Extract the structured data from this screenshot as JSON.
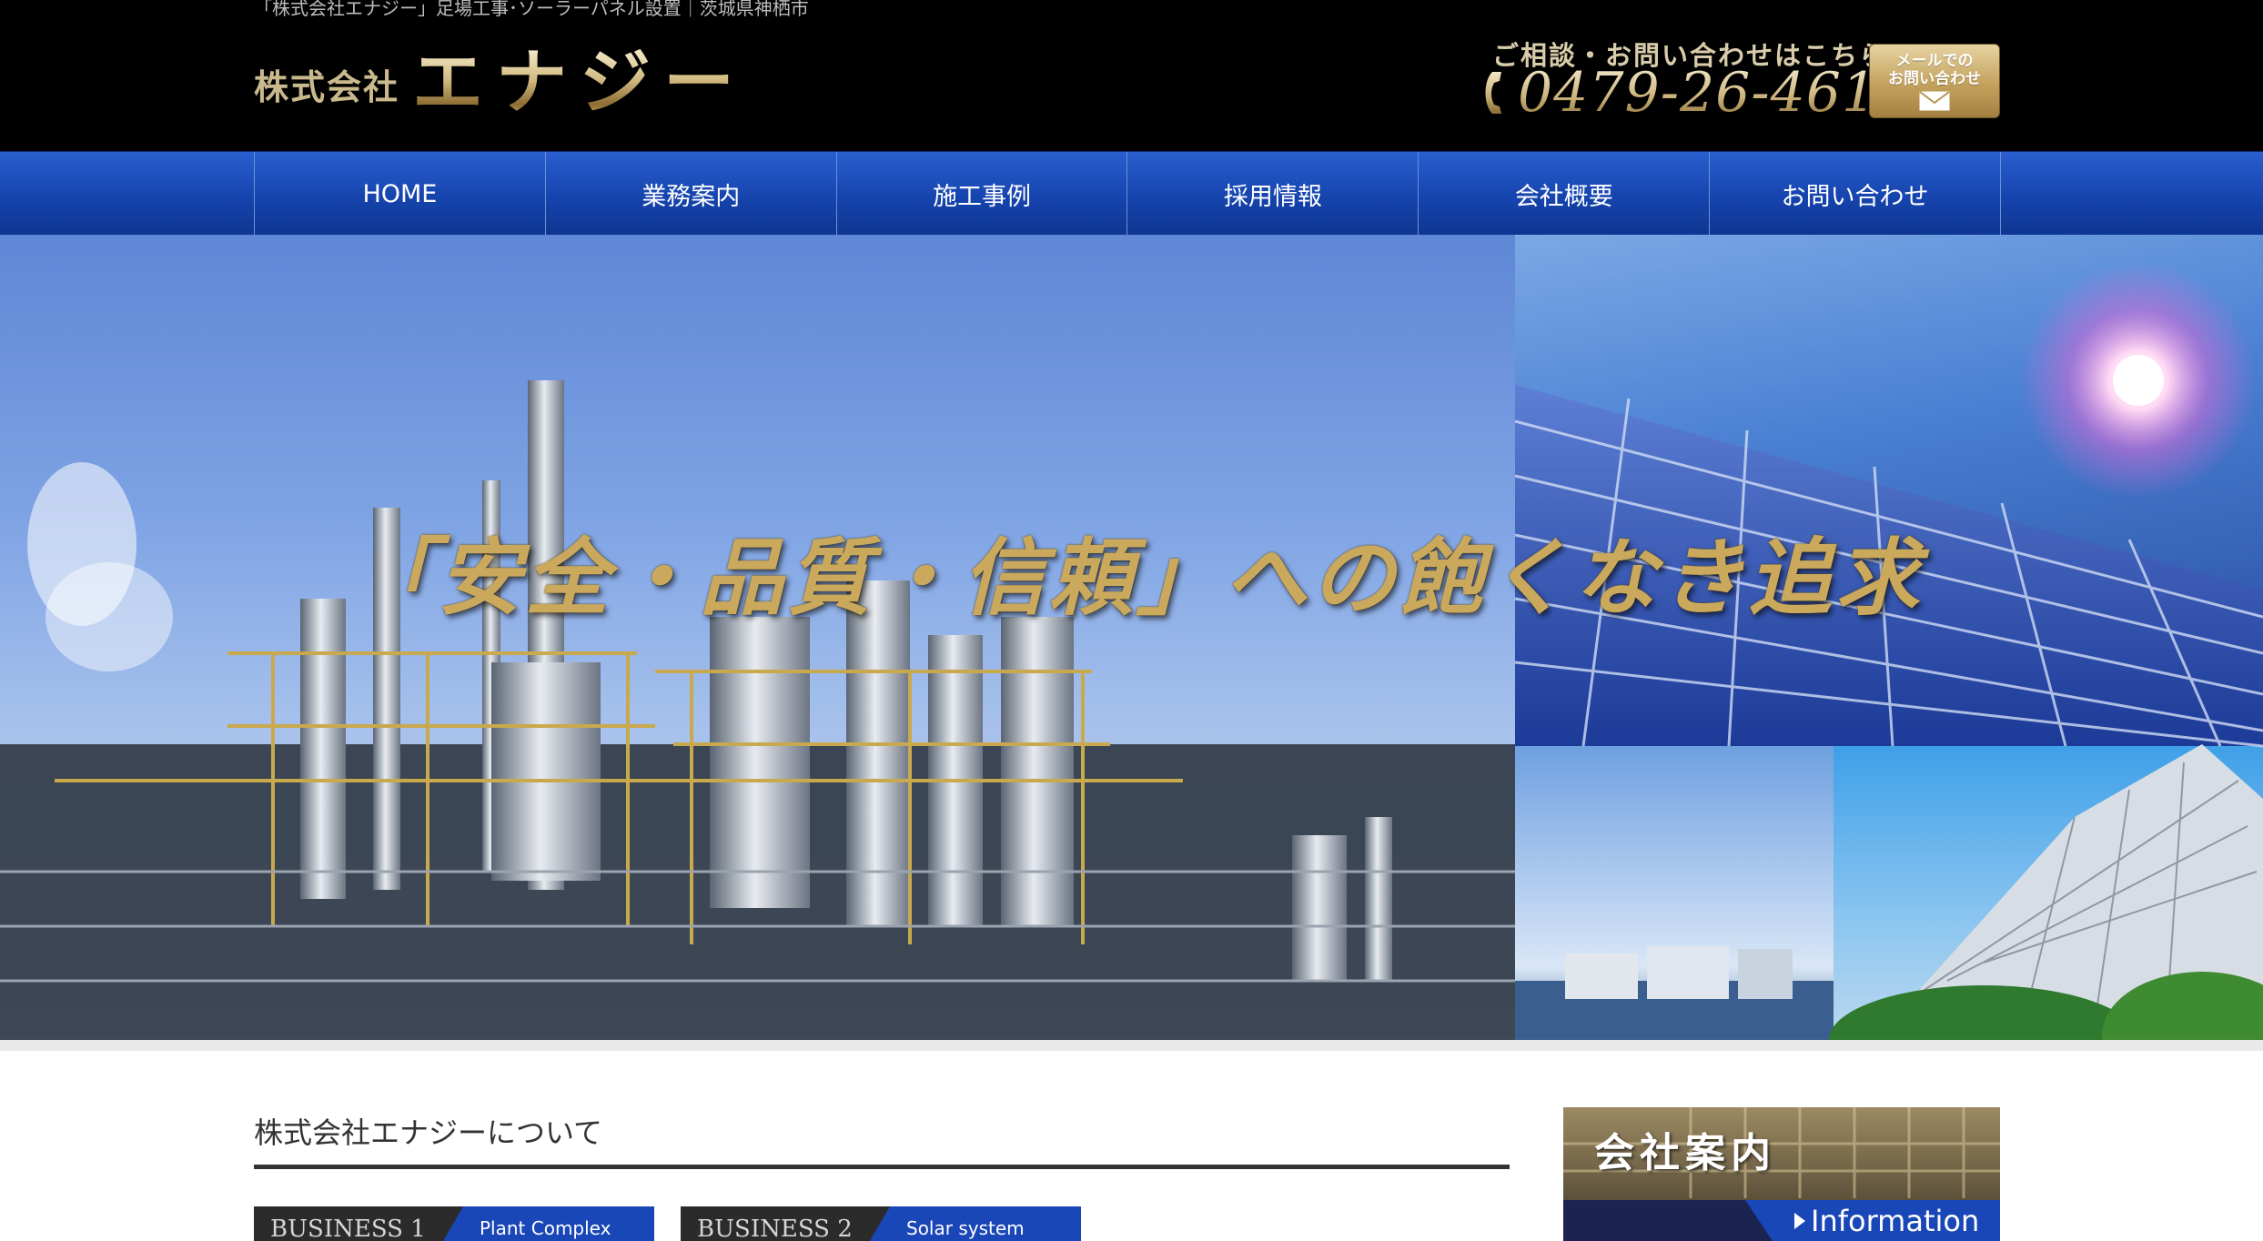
{
  "header": {
    "tagline": "「株式会社エナジー」足場工事･ソーラーパネル設置｜茨城県神栖市",
    "logo_prefix": "株式会社",
    "logo_main": "エナジー",
    "contact_label": "ご相談・お問い合わせはこちら",
    "phone": "0479-26-4615",
    "mail_line1": "メールでの",
    "mail_line2": "お問い合わせ"
  },
  "nav": {
    "items": [
      "HOME",
      "業務案内",
      "施工事例",
      "採用情報",
      "会社概要",
      "お問い合わせ"
    ]
  },
  "hero": {
    "headline": "「安全・品質・信頼」への飽くなき追求"
  },
  "main": {
    "section_title": "株式会社エナジーについて",
    "business": [
      {
        "label": "BUSINESS 1",
        "sub": "Plant  Complex"
      },
      {
        "label": "BUSINESS 2",
        "sub": "Solar system"
      }
    ]
  },
  "sidebar": {
    "banner_title": "会社案内",
    "banner_sub": "Information"
  },
  "colors": {
    "header_bg": "#000000",
    "nav_blue": "#1644ae",
    "gold": "#caa95d",
    "accent_blue": "#1a47b8"
  }
}
